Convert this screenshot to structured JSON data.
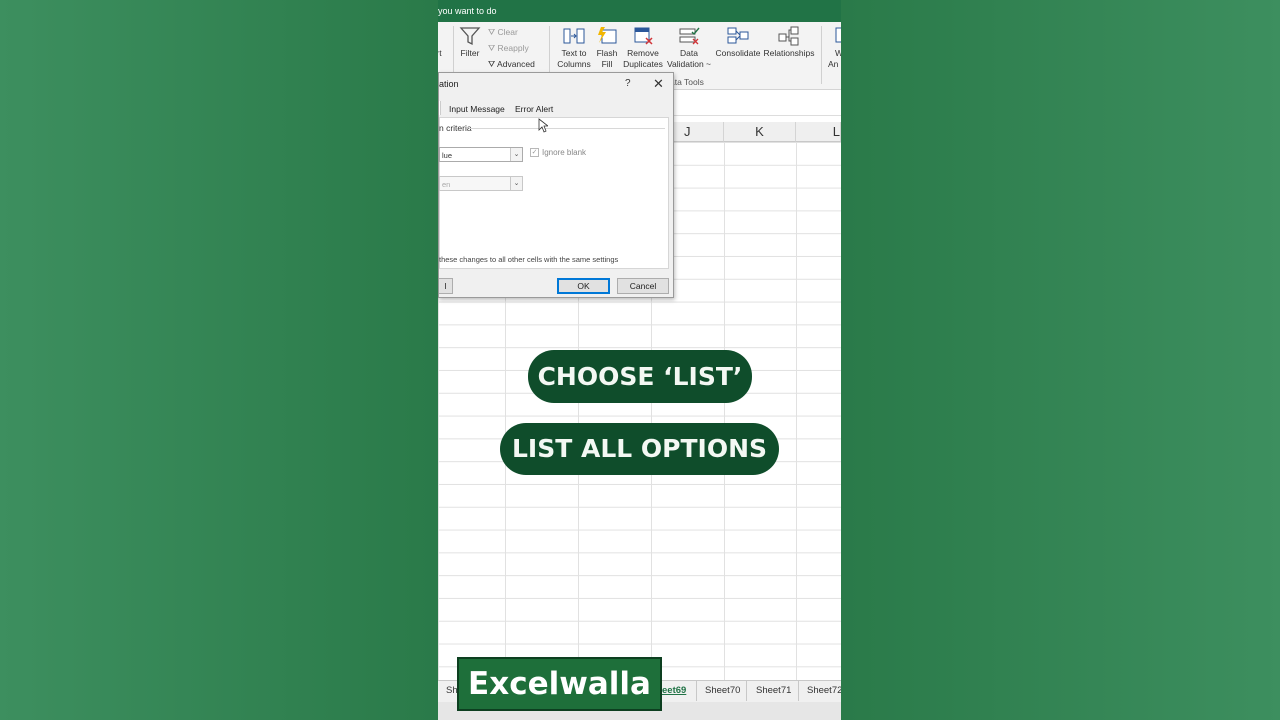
{
  "app": {
    "title_fragment": "you want to do",
    "accent": "#217346"
  },
  "ribbon": {
    "filter_label": "Filter",
    "clear_label": "Clear",
    "reapply_label": "Reapply",
    "advanced_label": "Advanced",
    "text_to_columns": "Text to Columns",
    "flash_fill": "Flash Fill",
    "remove_duplicates": "Remove Duplicates",
    "data_validation": "Data Validation ~",
    "consolidate": "Consolidate",
    "relationships": "Relationships",
    "group_label": "ata Tools",
    "left_fragment": "rt",
    "right_fragment_1": "W",
    "right_fragment_2": "An"
  },
  "columns": [
    "J",
    "K",
    "L"
  ],
  "dialog": {
    "title": "ation",
    "help": "?",
    "close": "✕",
    "tabs": [
      "Input Message",
      "Error Alert"
    ],
    "criteria_label": "n criteria",
    "allow_value": "lue",
    "data_value": "en",
    "ignore_blank": "Ignore blank",
    "apply_text": "these changes to all other cells with the same settings",
    "left_button": "l",
    "ok": "OK",
    "cancel": "Cancel"
  },
  "overlay": {
    "step1": "CHOOSE ‘LIST’",
    "step2": "LIST ALL OPTIONS"
  },
  "sheet_tabs": {
    "first": "She",
    "active": "eet69",
    "tabs": [
      "Sheet70",
      "Sheet71",
      "Sheet72"
    ]
  },
  "brand": "Excelwalla"
}
